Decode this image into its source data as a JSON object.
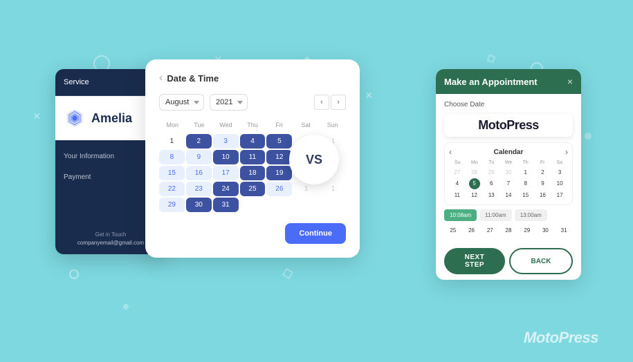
{
  "page": {
    "bg_color": "#7dd8e0"
  },
  "amelia": {
    "service_label": "Service",
    "your_information_label": "Your Information",
    "payment_label": "Payment",
    "get_in_touch_label": "Get in Touch",
    "email_label": "companyemail@gmail.com",
    "logo_text": "Amelia"
  },
  "calendar": {
    "back_label": "‹",
    "title": "Date & Time",
    "month_value": "August",
    "year_value": "2021",
    "days_header": [
      "Mon",
      "Tue",
      "Wed",
      "Thu",
      "Fri",
      "Sat",
      "Sun"
    ],
    "continue_label": "Continue"
  },
  "vs": {
    "label": "VS"
  },
  "motopress": {
    "title": "Make an Appointment",
    "close_label": "×",
    "choose_date_label": "Choose Date",
    "logo_text": "MotoPress",
    "calendar_label": "Calendar",
    "days_header": [
      "Su",
      "Mo",
      "Tu",
      "We",
      "Th",
      "Fr",
      "Sa"
    ],
    "times": [
      "10:08am",
      "11:00am",
      "13:00am"
    ],
    "next_step_label": "NEXT STEP",
    "back_label": "BACK"
  },
  "watermark": {
    "text": "MotoPress"
  }
}
